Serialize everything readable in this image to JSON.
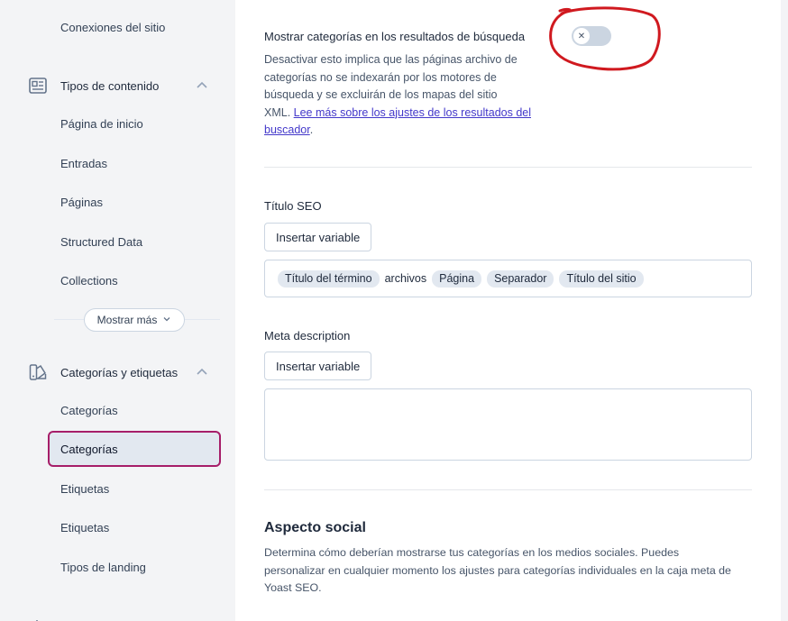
{
  "sidebar": {
    "top_item": "Conexiones del sitio",
    "content_types": {
      "title": "Tipos de contenido",
      "icon": "document-icon",
      "items": [
        "Página de inicio",
        "Entradas",
        "Páginas",
        "Structured Data",
        "Collections"
      ],
      "show_more": "Mostrar más"
    },
    "taxonomies": {
      "title": "Categorías y etiquetas",
      "icon": "tag-shapes-icon",
      "items": [
        "Categorías",
        "Categorías",
        "Etiquetas",
        "Etiquetas",
        "Tipos de landing"
      ],
      "active_index": 1
    }
  },
  "main": {
    "search_setting": {
      "label": "Mostrar categorías en los resultados de búsqueda",
      "desc_lines": [
        "Desactivar esto implica que las páginas archivo de",
        "categorías no se indexarán por los motores de",
        "búsqueda y se excluirán de los mapas del sitio"
      ],
      "desc_prefix": "XML. ",
      "link_line1": "Lee más sobre los ajustes de los resultados del",
      "link_line2": "buscador",
      "desc_suffix": ".",
      "toggle_state": "off",
      "annotation_color": "#d0191f"
    },
    "seo_title": {
      "label": "Título SEO",
      "insert_button": "Insertar variable",
      "chips": [
        "Título del término",
        "archivos",
        "Página",
        "Separador",
        "Título del sitio"
      ]
    },
    "meta_description": {
      "label": "Meta description",
      "insert_button": "Insertar variable",
      "value": ""
    },
    "social": {
      "title": "Aspecto social",
      "desc_lines": [
        "Determina cómo deberían mostrarse tus categorías en los medios sociales. Puedes",
        "personalizar en cualquier momento los ajustes para categorías individuales en la caja meta de",
        "Yoast SEO."
      ]
    }
  },
  "colors": {
    "accent": "#a61e69",
    "link": "#4338ca"
  }
}
